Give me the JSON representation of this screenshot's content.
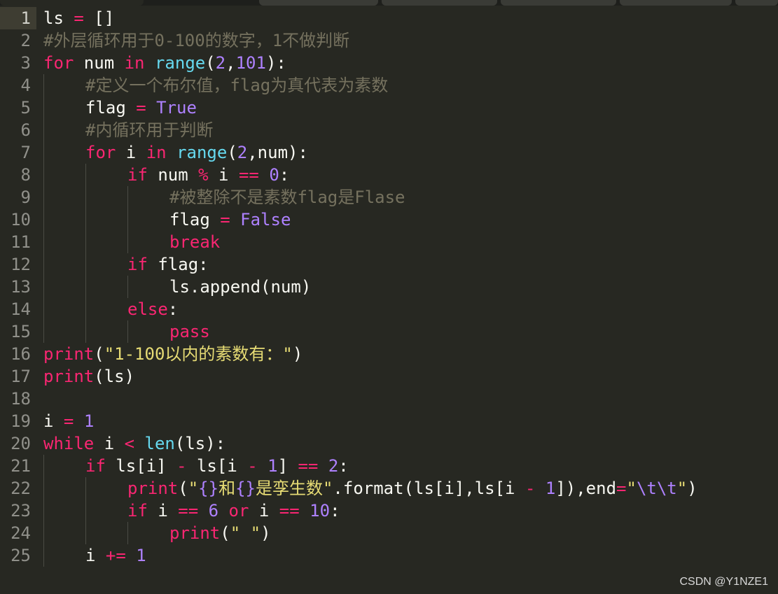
{
  "editor": {
    "watermark": "CSDN @Y1NZE1",
    "current_line": 1,
    "lines": [
      {
        "num": "1",
        "indent": 0,
        "tokens": [
          {
            "t": "ls ",
            "c": "p"
          },
          {
            "t": "=",
            "c": "o"
          },
          {
            "t": " []",
            "c": "p"
          }
        ]
      },
      {
        "num": "2",
        "indent": 0,
        "tokens": [
          {
            "t": "#外层循环用于0-100的数字，1不做判断",
            "c": "c"
          }
        ]
      },
      {
        "num": "3",
        "indent": 0,
        "tokens": [
          {
            "t": "for",
            "c": "k"
          },
          {
            "t": " num ",
            "c": "p"
          },
          {
            "t": "in",
            "c": "k"
          },
          {
            "t": " ",
            "c": "p"
          },
          {
            "t": "range",
            "c": "b"
          },
          {
            "t": "(",
            "c": "p"
          },
          {
            "t": "2",
            "c": "n"
          },
          {
            "t": ",",
            "c": "p"
          },
          {
            "t": "101",
            "c": "n"
          },
          {
            "t": "):",
            "c": "p"
          }
        ]
      },
      {
        "num": "4",
        "indent": 1,
        "tokens": [
          {
            "t": "#定义一个布尔值，flag为真代表为素数",
            "c": "c"
          }
        ]
      },
      {
        "num": "5",
        "indent": 1,
        "tokens": [
          {
            "t": "flag ",
            "c": "p"
          },
          {
            "t": "=",
            "c": "o"
          },
          {
            "t": " ",
            "c": "p"
          },
          {
            "t": "True",
            "c": "n"
          }
        ]
      },
      {
        "num": "6",
        "indent": 1,
        "tokens": [
          {
            "t": "#内循环用于判断",
            "c": "c"
          }
        ]
      },
      {
        "num": "7",
        "indent": 1,
        "tokens": [
          {
            "t": "for",
            "c": "k"
          },
          {
            "t": " i ",
            "c": "p"
          },
          {
            "t": "in",
            "c": "k"
          },
          {
            "t": " ",
            "c": "p"
          },
          {
            "t": "range",
            "c": "b"
          },
          {
            "t": "(",
            "c": "p"
          },
          {
            "t": "2",
            "c": "n"
          },
          {
            "t": ",num):",
            "c": "p"
          }
        ]
      },
      {
        "num": "8",
        "indent": 2,
        "tokens": [
          {
            "t": "if",
            "c": "k"
          },
          {
            "t": " num ",
            "c": "p"
          },
          {
            "t": "%",
            "c": "o"
          },
          {
            "t": " i ",
            "c": "p"
          },
          {
            "t": "==",
            "c": "o"
          },
          {
            "t": " ",
            "c": "p"
          },
          {
            "t": "0",
            "c": "n"
          },
          {
            "t": ":",
            "c": "p"
          }
        ]
      },
      {
        "num": "9",
        "indent": 3,
        "tokens": [
          {
            "t": "#被整除不是素数flag是Flase",
            "c": "c"
          }
        ]
      },
      {
        "num": "10",
        "indent": 3,
        "tokens": [
          {
            "t": "flag ",
            "c": "p"
          },
          {
            "t": "=",
            "c": "o"
          },
          {
            "t": " ",
            "c": "p"
          },
          {
            "t": "False",
            "c": "n"
          }
        ]
      },
      {
        "num": "11",
        "indent": 3,
        "tokens": [
          {
            "t": "break",
            "c": "k"
          }
        ]
      },
      {
        "num": "12",
        "indent": 2,
        "tokens": [
          {
            "t": "if",
            "c": "k"
          },
          {
            "t": " flag:",
            "c": "p"
          }
        ]
      },
      {
        "num": "13",
        "indent": 3,
        "tokens": [
          {
            "t": "ls.append(num)",
            "c": "p"
          }
        ]
      },
      {
        "num": "14",
        "indent": 2,
        "tokens": [
          {
            "t": "else",
            "c": "k"
          },
          {
            "t": ":",
            "c": "p"
          }
        ]
      },
      {
        "num": "15",
        "indent": 3,
        "tokens": [
          {
            "t": "pass",
            "c": "k"
          }
        ]
      },
      {
        "num": "16",
        "indent": 0,
        "tokens": [
          {
            "t": "print",
            "c": "k"
          },
          {
            "t": "(",
            "c": "p"
          },
          {
            "t": "\"1-100以内的素数有：\"",
            "c": "s"
          },
          {
            "t": ")",
            "c": "p"
          }
        ]
      },
      {
        "num": "17",
        "indent": 0,
        "tokens": [
          {
            "t": "print",
            "c": "k"
          },
          {
            "t": "(ls)",
            "c": "p"
          }
        ]
      },
      {
        "num": "18",
        "indent": 0,
        "tokens": []
      },
      {
        "num": "19",
        "indent": 0,
        "tokens": [
          {
            "t": "i ",
            "c": "p"
          },
          {
            "t": "=",
            "c": "o"
          },
          {
            "t": " ",
            "c": "p"
          },
          {
            "t": "1",
            "c": "n"
          }
        ]
      },
      {
        "num": "20",
        "indent": 0,
        "tokens": [
          {
            "t": "while",
            "c": "k"
          },
          {
            "t": " i ",
            "c": "p"
          },
          {
            "t": "<",
            "c": "o"
          },
          {
            "t": " ",
            "c": "p"
          },
          {
            "t": "len",
            "c": "b"
          },
          {
            "t": "(ls):",
            "c": "p"
          }
        ]
      },
      {
        "num": "21",
        "indent": 1,
        "tokens": [
          {
            "t": "if",
            "c": "k"
          },
          {
            "t": " ls[i] ",
            "c": "p"
          },
          {
            "t": "-",
            "c": "o"
          },
          {
            "t": " ls[i ",
            "c": "p"
          },
          {
            "t": "-",
            "c": "o"
          },
          {
            "t": " ",
            "c": "p"
          },
          {
            "t": "1",
            "c": "n"
          },
          {
            "t": "] ",
            "c": "p"
          },
          {
            "t": "==",
            "c": "o"
          },
          {
            "t": " ",
            "c": "p"
          },
          {
            "t": "2",
            "c": "n"
          },
          {
            "t": ":",
            "c": "p"
          }
        ]
      },
      {
        "num": "22",
        "indent": 2,
        "tokens": [
          {
            "t": "print",
            "c": "k"
          },
          {
            "t": "(",
            "c": "p"
          },
          {
            "t": "\"",
            "c": "s"
          },
          {
            "t": "{}",
            "c": "n"
          },
          {
            "t": "和",
            "c": "s"
          },
          {
            "t": "{}",
            "c": "n"
          },
          {
            "t": "是孪生数\"",
            "c": "s"
          },
          {
            "t": ".format(ls[i],ls[i ",
            "c": "p"
          },
          {
            "t": "-",
            "c": "o"
          },
          {
            "t": " ",
            "c": "p"
          },
          {
            "t": "1",
            "c": "n"
          },
          {
            "t": "]),end",
            "c": "p"
          },
          {
            "t": "=",
            "c": "o"
          },
          {
            "t": "\"",
            "c": "s"
          },
          {
            "t": "\\t\\t",
            "c": "n"
          },
          {
            "t": "\"",
            "c": "s"
          },
          {
            "t": ")",
            "c": "p"
          }
        ]
      },
      {
        "num": "23",
        "indent": 2,
        "tokens": [
          {
            "t": "if",
            "c": "k"
          },
          {
            "t": " i ",
            "c": "p"
          },
          {
            "t": "==",
            "c": "o"
          },
          {
            "t": " ",
            "c": "p"
          },
          {
            "t": "6",
            "c": "n"
          },
          {
            "t": " ",
            "c": "p"
          },
          {
            "t": "or",
            "c": "k"
          },
          {
            "t": " i ",
            "c": "p"
          },
          {
            "t": "==",
            "c": "o"
          },
          {
            "t": " ",
            "c": "p"
          },
          {
            "t": "10",
            "c": "n"
          },
          {
            "t": ":",
            "c": "p"
          }
        ]
      },
      {
        "num": "24",
        "indent": 3,
        "tokens": [
          {
            "t": "print",
            "c": "k"
          },
          {
            "t": "(",
            "c": "p"
          },
          {
            "t": "\" \"",
            "c": "s"
          },
          {
            "t": ")",
            "c": "p"
          }
        ]
      },
      {
        "num": "25",
        "indent": 1,
        "tokens": [
          {
            "t": "i ",
            "c": "p"
          },
          {
            "t": "+=",
            "c": "o"
          },
          {
            "t": " ",
            "c": "p"
          },
          {
            "t": "1",
            "c": "n"
          }
        ]
      }
    ]
  }
}
